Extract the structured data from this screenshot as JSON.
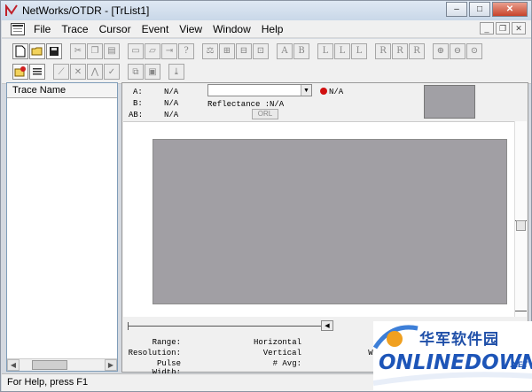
{
  "window": {
    "title": "NetWorks/OTDR - [TrList1]",
    "controls": {
      "minimize": "–",
      "maximize": "□",
      "close": "✕"
    }
  },
  "menubar": {
    "items": [
      "File",
      "Trace",
      "Cursor",
      "Event",
      "View",
      "Window",
      "Help"
    ],
    "mdi_controls": {
      "minimize": "_",
      "restore": "❐",
      "close": "✕"
    }
  },
  "toolbar1": {
    "icons": [
      "new-icon",
      "open-icon",
      "save-icon",
      "cut-icon",
      "copy-icon",
      "paste-icon",
      "print-preview-icon",
      "print-icon",
      "export-icon",
      "help-cursor-icon",
      "compare-icon",
      "fit-icon",
      "split-icon",
      "center-icon",
      "zoom-in-icon",
      "zoom-out-icon",
      "zoom-fit-icon"
    ],
    "marker_labels": [
      "A",
      "B",
      "L",
      "L",
      "L",
      "R",
      "R",
      "R"
    ]
  },
  "toolbar2": {
    "icons": [
      "load-trace-icon",
      "list-icon",
      "slope-icon",
      "splice-icon",
      "event-icon",
      "tool-icon",
      "overlay-icon",
      "window-icon",
      "analyze-icon"
    ]
  },
  "trace_list": {
    "header": "Trace Name"
  },
  "info": {
    "a_label": "A:",
    "a_value": "N/A",
    "b_label": "B:",
    "b_value": "N/A",
    "ab_label": "AB:",
    "ab_value": "N/A",
    "marker_value": "N/A",
    "reflectance_label": "Reflectance :",
    "reflectance_value": "N/A",
    "orl_button": "ORL"
  },
  "stats": {
    "range_label": "Range:",
    "resolution_label": "Resolution:",
    "pulse_width_label": "Pulse Width:",
    "horizontal_label": "Horizontal",
    "vertical_label": "Vertical",
    "avg_label": "# Avg:",
    "wave_partial": "Wa"
  },
  "statusbar": {
    "text": "For Help, press F1"
  },
  "watermark": {
    "cn_text": "华军软件园",
    "en_text": "ONLINEDOWN",
    "suffix": ".NET"
  },
  "colors": {
    "plot_bg": "#a19fa4",
    "marker_dot": "#d01010",
    "watermark_blue": "#1d55b8"
  }
}
